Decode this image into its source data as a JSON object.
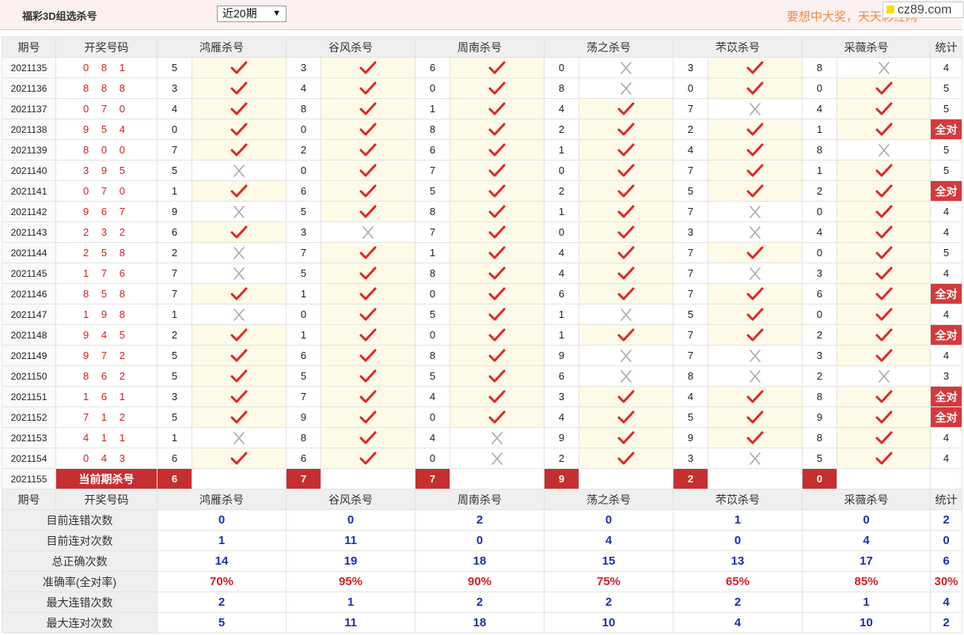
{
  "header": {
    "title": "福彩3D组选杀号",
    "period_select": "近20期",
    "slogan": "要想中大奖，天天彩经网",
    "site_logo": "cz89.com"
  },
  "colors": {
    "accent": "#d42020",
    "blue_value": "#1b2fb5",
    "ok_cell_bg": "#fdfbe8",
    "slogan": "#f08a3e"
  },
  "columns": [
    "期号",
    "开奖号码",
    "鸿雁杀号",
    "谷风杀号",
    "周南杀号",
    "荡之杀号",
    "芣苡杀号",
    "采薇杀号",
    "统计"
  ],
  "rows": [
    {
      "period": "2021135",
      "draw": "0 8 1",
      "k": [
        "5",
        "3",
        "6",
        "0",
        "3",
        "8"
      ],
      "r": [
        1,
        1,
        1,
        0,
        1,
        0
      ],
      "stat": "4"
    },
    {
      "period": "2021136",
      "draw": "8 8 8",
      "k": [
        "3",
        "4",
        "0",
        "8",
        "0",
        "0"
      ],
      "r": [
        1,
        1,
        1,
        0,
        1,
        1
      ],
      "stat": "5"
    },
    {
      "period": "2021137",
      "draw": "0 7 0",
      "k": [
        "4",
        "8",
        "1",
        "4",
        "7",
        "4"
      ],
      "r": [
        1,
        1,
        1,
        1,
        0,
        1
      ],
      "stat": "5"
    },
    {
      "period": "2021138",
      "draw": "9 5 4",
      "k": [
        "0",
        "0",
        "8",
        "2",
        "2",
        "1"
      ],
      "r": [
        1,
        1,
        1,
        1,
        1,
        1
      ],
      "stat": "全对"
    },
    {
      "period": "2021139",
      "draw": "8 0 0",
      "k": [
        "7",
        "2",
        "6",
        "1",
        "4",
        "8"
      ],
      "r": [
        1,
        1,
        1,
        1,
        1,
        0
      ],
      "stat": "5"
    },
    {
      "period": "2021140",
      "draw": "3 9 5",
      "k": [
        "5",
        "0",
        "7",
        "0",
        "7",
        "1"
      ],
      "r": [
        0,
        1,
        1,
        1,
        1,
        1
      ],
      "stat": "5"
    },
    {
      "period": "2021141",
      "draw": "0 7 0",
      "k": [
        "1",
        "6",
        "5",
        "2",
        "5",
        "2"
      ],
      "r": [
        1,
        1,
        1,
        1,
        1,
        1
      ],
      "stat": "全对"
    },
    {
      "period": "2021142",
      "draw": "9 6 7",
      "k": [
        "9",
        "5",
        "8",
        "1",
        "7",
        "0"
      ],
      "r": [
        0,
        1,
        1,
        1,
        0,
        1
      ],
      "stat": "4"
    },
    {
      "period": "2021143",
      "draw": "2 3 2",
      "k": [
        "6",
        "3",
        "7",
        "0",
        "3",
        "4"
      ],
      "r": [
        1,
        0,
        1,
        1,
        0,
        1
      ],
      "stat": "4"
    },
    {
      "period": "2021144",
      "draw": "2 5 8",
      "k": [
        "2",
        "7",
        "1",
        "4",
        "7",
        "0"
      ],
      "r": [
        0,
        1,
        1,
        1,
        1,
        1
      ],
      "stat": "5"
    },
    {
      "period": "2021145",
      "draw": "1 7 6",
      "k": [
        "7",
        "5",
        "8",
        "4",
        "7",
        "3"
      ],
      "r": [
        0,
        1,
        1,
        1,
        0,
        1
      ],
      "stat": "4"
    },
    {
      "period": "2021146",
      "draw": "8 5 8",
      "k": [
        "7",
        "1",
        "0",
        "6",
        "7",
        "6"
      ],
      "r": [
        1,
        1,
        1,
        1,
        1,
        1
      ],
      "stat": "全对"
    },
    {
      "period": "2021147",
      "draw": "1 9 8",
      "k": [
        "1",
        "0",
        "5",
        "1",
        "5",
        "0"
      ],
      "r": [
        0,
        1,
        1,
        0,
        1,
        1
      ],
      "stat": "4"
    },
    {
      "period": "2021148",
      "draw": "9 4 5",
      "k": [
        "2",
        "1",
        "0",
        "1",
        "7",
        "2"
      ],
      "r": [
        1,
        1,
        1,
        1,
        1,
        1
      ],
      "stat": "全对"
    },
    {
      "period": "2021149",
      "draw": "9 7 2",
      "k": [
        "5",
        "6",
        "8",
        "9",
        "7",
        "3"
      ],
      "r": [
        1,
        1,
        1,
        0,
        0,
        1
      ],
      "stat": "4"
    },
    {
      "period": "2021150",
      "draw": "8 6 2",
      "k": [
        "5",
        "5",
        "5",
        "6",
        "8",
        "2"
      ],
      "r": [
        1,
        1,
        1,
        0,
        0,
        0
      ],
      "stat": "3"
    },
    {
      "period": "2021151",
      "draw": "1 6 1",
      "k": [
        "3",
        "7",
        "4",
        "3",
        "4",
        "8"
      ],
      "r": [
        1,
        1,
        1,
        1,
        1,
        1
      ],
      "stat": "全对"
    },
    {
      "period": "2021152",
      "draw": "7 1 2",
      "k": [
        "5",
        "9",
        "0",
        "4",
        "5",
        "9"
      ],
      "r": [
        1,
        1,
        1,
        1,
        1,
        1
      ],
      "stat": "全对"
    },
    {
      "period": "2021153",
      "draw": "4 1 1",
      "k": [
        "1",
        "8",
        "4",
        "9",
        "9",
        "8"
      ],
      "r": [
        0,
        1,
        0,
        1,
        1,
        1
      ],
      "stat": "4"
    },
    {
      "period": "2021154",
      "draw": "0 4 3",
      "k": [
        "6",
        "6",
        "0",
        "2",
        "3",
        "5"
      ],
      "r": [
        1,
        1,
        0,
        1,
        0,
        1
      ],
      "stat": "4"
    }
  ],
  "current": {
    "period": "2021155",
    "label": "当前期杀号",
    "kills": [
      "6",
      "7",
      "7",
      "9",
      "2",
      "0"
    ]
  },
  "summary": [
    {
      "label": "目前连错次数",
      "values": [
        "0",
        "0",
        "2",
        "0",
        "1",
        "0",
        "2"
      ]
    },
    {
      "label": "目前连对次数",
      "values": [
        "1",
        "11",
        "0",
        "4",
        "0",
        "4",
        "0"
      ]
    },
    {
      "label": "总正确次数",
      "values": [
        "14",
        "19",
        "18",
        "15",
        "13",
        "17",
        "6"
      ]
    },
    {
      "label": "准确率(全对率)",
      "values": [
        "70%",
        "95%",
        "90%",
        "75%",
        "65%",
        "85%",
        "30%"
      ],
      "rate": true
    },
    {
      "label": "最大连错次数",
      "values": [
        "2",
        "1",
        "2",
        "2",
        "2",
        "1",
        "4"
      ]
    },
    {
      "label": "最大连对次数",
      "values": [
        "5",
        "11",
        "18",
        "10",
        "4",
        "10",
        "2"
      ]
    }
  ],
  "icons": {
    "correct": "check-mark-icon",
    "wrong": "cross-mark-icon"
  }
}
